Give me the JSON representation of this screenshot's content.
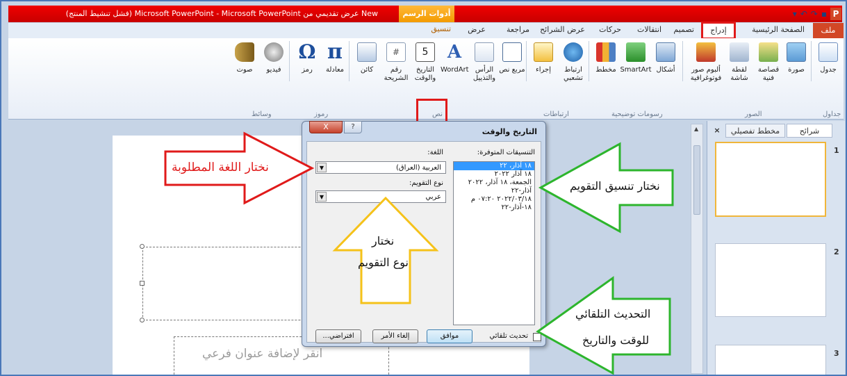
{
  "title_bar": {
    "title": "New عرض تقديمي من Microsoft PowerPoint - Microsoft PowerPoint (فشل تنشيط المنتج)",
    "drawing_tools": "أدوات الرسم"
  },
  "tabs": {
    "file": "ملف",
    "home": "الصفحة الرئيسية",
    "insert": "إدراج",
    "design": "تصميم",
    "transitions": "انتقالات",
    "animations": "حركات",
    "slideshow": "عرض الشرائح",
    "review": "مراجعة",
    "view": "عرض",
    "format": "تنسيق"
  },
  "ribbon": {
    "buttons": {
      "table": "جدول",
      "picture": "صورة",
      "clipart": "قصاصة فنية",
      "screenshot": "لقطة شاشة",
      "photo_album": "ألبوم صور فوتوغرافية",
      "shapes": "أشكال",
      "smartart": "SmartArt",
      "chart": "مخطط",
      "hyperlink": "ارتباط تشعبي",
      "action": "إجراء",
      "textbox": "مربع نص",
      "header_footer": "الرأس والتذييل",
      "wordart": "WordArt",
      "date_time": "التاريخ والوقت",
      "slide_number": "رقم الشريحة",
      "object": "كائن",
      "equation": "معادلة",
      "symbol": "رمز",
      "video": "فيديو",
      "audio": "صوت"
    },
    "groups": {
      "tables": "جداول",
      "images": "الصور",
      "illustrations": "رسومات توضيحية",
      "links": "ارتباطات",
      "text": "نص",
      "symbols": "رموز",
      "media": "وسائط"
    }
  },
  "side_pane": {
    "tab_slides": "شرائح",
    "tab_outline": "مخطط تفصيلي",
    "thumbs": [
      "1",
      "2",
      "3"
    ]
  },
  "slide": {
    "subtitle_placeholder": "انقر لإضافة عنوان فرعي"
  },
  "dialog": {
    "title": "التاريخ والوقت",
    "close": "X",
    "help": "?",
    "formats_label": "التنسيقات المتوفرة:",
    "formats": [
      "١٨ آذار، ٢٢",
      "١٨ آذار ٢٠٢٢",
      "الجمعة، ١٨ آذار، ٢٠٢٢",
      "آذار-٢٢",
      "٢٠٢٢/٠٣/١٨ ٠٧:٢٠ م",
      "١٨-آذار-٢٢"
    ],
    "language_label": "اللغة:",
    "language_value": "العربية (العراق)",
    "calendar_label": "نوع التقويم:",
    "calendar_value": "عربي",
    "auto_update": "تحديث تلقائي",
    "ok": "موافق",
    "cancel": "إلغاء الأمر",
    "default": "افتراضي..."
  },
  "annotations": {
    "language": "نختار اللغة المطلوبة",
    "format": "نختار تنسيق التقويم",
    "calendar_line1": "نختار",
    "calendar_line2": "نوع التقويم",
    "auto_line1": "التحديث التلقائي",
    "auto_line2": "للوقت والتاريخ"
  },
  "colors": {
    "accent_red": "#e01a1a",
    "arrow_green": "#2db52d",
    "arrow_yellow": "#f5c21a",
    "file_tab": "#d24726"
  }
}
